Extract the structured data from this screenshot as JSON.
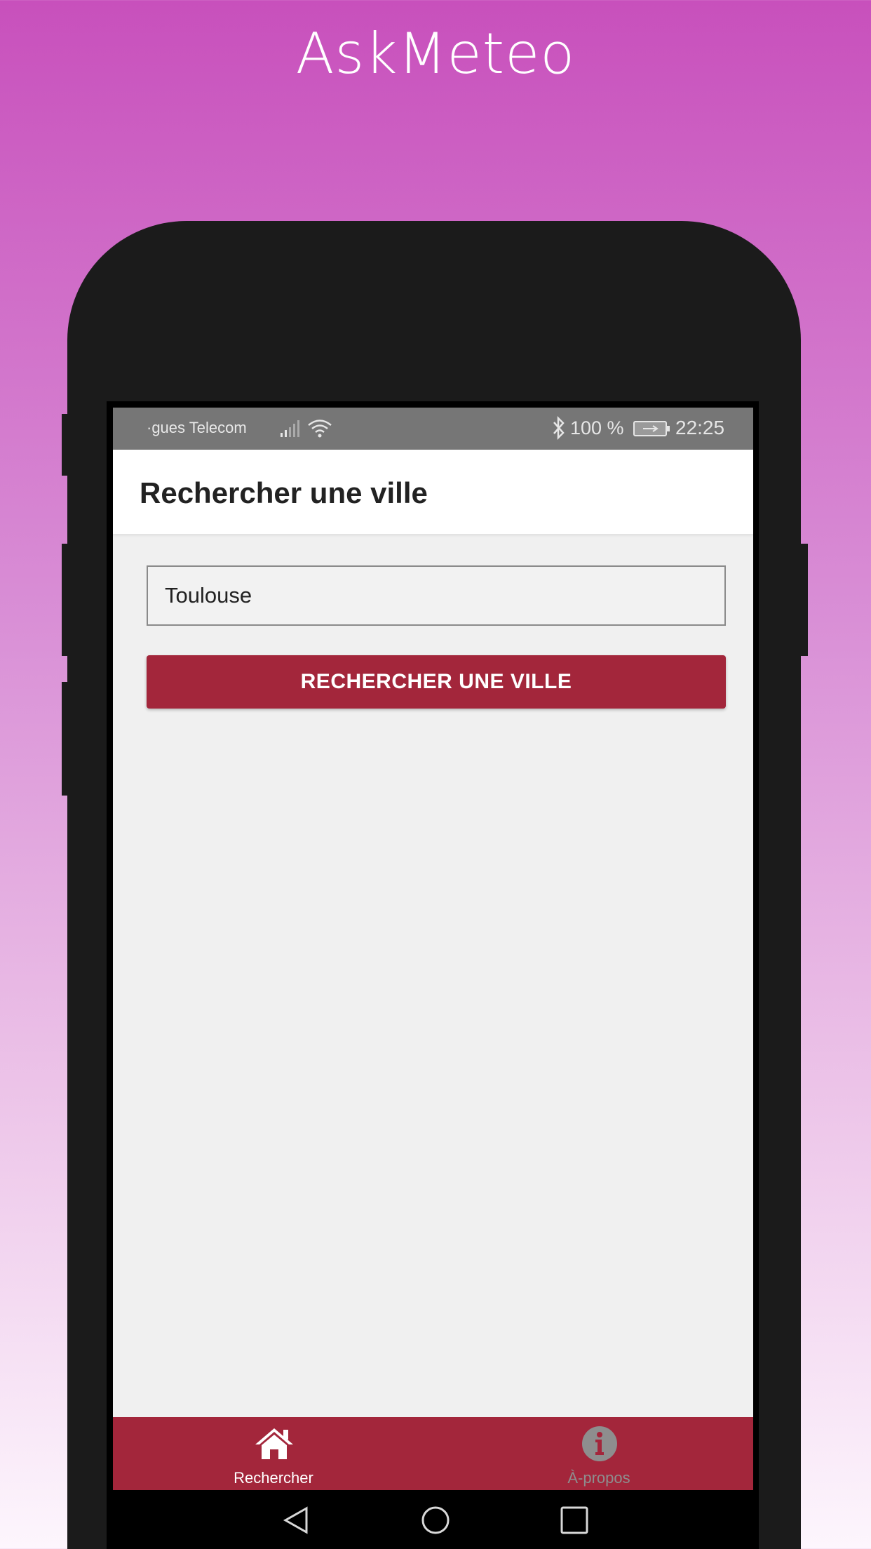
{
  "header": {
    "title": "AskMeteo"
  },
  "status_bar": {
    "carrier": "·gues Telecom",
    "battery": "100 %",
    "time": "22:25",
    "icons": [
      "signal-icon",
      "wifi-icon",
      "bluetooth-icon",
      "battery-icon"
    ]
  },
  "action_bar": {
    "title": "Rechercher une ville"
  },
  "search": {
    "value": "Toulouse",
    "button_label": "RECHERCHER UNE VILLE"
  },
  "bottom_nav": {
    "items": [
      {
        "label": "Rechercher",
        "icon": "home-icon",
        "active": true
      },
      {
        "label": "À-propos",
        "icon": "info-icon",
        "active": false
      }
    ]
  },
  "system_nav": {
    "icons": [
      "back-icon",
      "home-circle-icon",
      "recents-icon"
    ]
  },
  "colors": {
    "accent": "#a3263b",
    "background_top": "#c850bc",
    "background_bottom": "#fdf6fd",
    "phone_body": "#1b1b1b",
    "status_bar": "#767676",
    "inactive_nav": "#8e8e8e"
  }
}
